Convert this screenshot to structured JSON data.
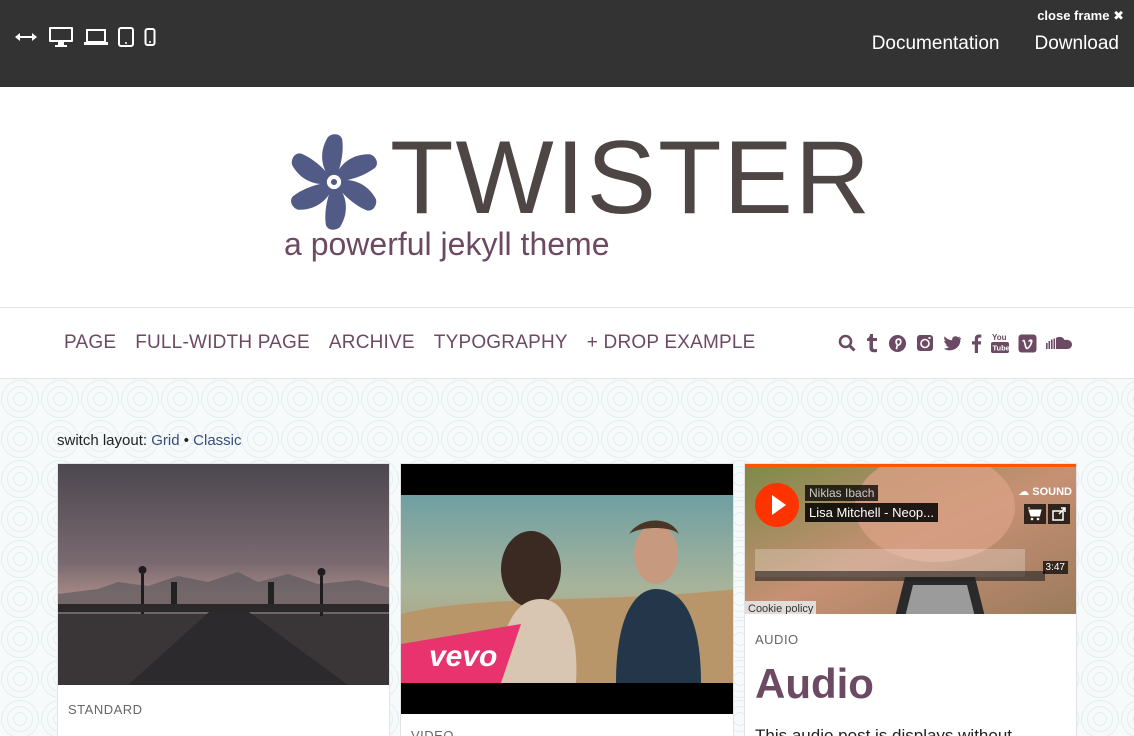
{
  "frame": {
    "close_label": "close frame",
    "close_icon": "times-icon",
    "nav": [
      "Documentation",
      "Download"
    ],
    "devices": [
      "fullwidth-icon",
      "desktop-icon",
      "laptop-icon",
      "tablet-icon",
      "mobile-icon"
    ]
  },
  "site": {
    "title": "TWISTER",
    "tagline": "a powerful jekyll theme",
    "colors": {
      "brand": "#6d4a63",
      "logo_mark": "#525b85",
      "title": "#4e4545"
    }
  },
  "menu": [
    "PAGE",
    "FULL-WIDTH PAGE",
    "ARCHIVE",
    "TYPOGRAPHY",
    "+ DROP EXAMPLE"
  ],
  "social": [
    "search-icon",
    "tumblr-icon",
    "pinterest-icon",
    "instagram-icon",
    "twitter-icon",
    "facebook-icon",
    "youtube-icon",
    "vimeo-icon",
    "soundcloud-icon"
  ],
  "layout_switch": {
    "label": "switch layout:",
    "grid": "Grid",
    "separator": "•",
    "classic": "Classic"
  },
  "posts": [
    {
      "kind": "STANDARD"
    },
    {
      "kind": "VIDEO",
      "badge": "vevo"
    },
    {
      "kind": "AUDIO",
      "title": "Audio",
      "excerpt": "This audio post is displays without",
      "player": {
        "artist": "Niklas Ibach",
        "track": "Lisa Mitchell - Neop...",
        "brand": "SOUND",
        "duration": "3:47",
        "cookie": "Cookie policy"
      }
    }
  ]
}
